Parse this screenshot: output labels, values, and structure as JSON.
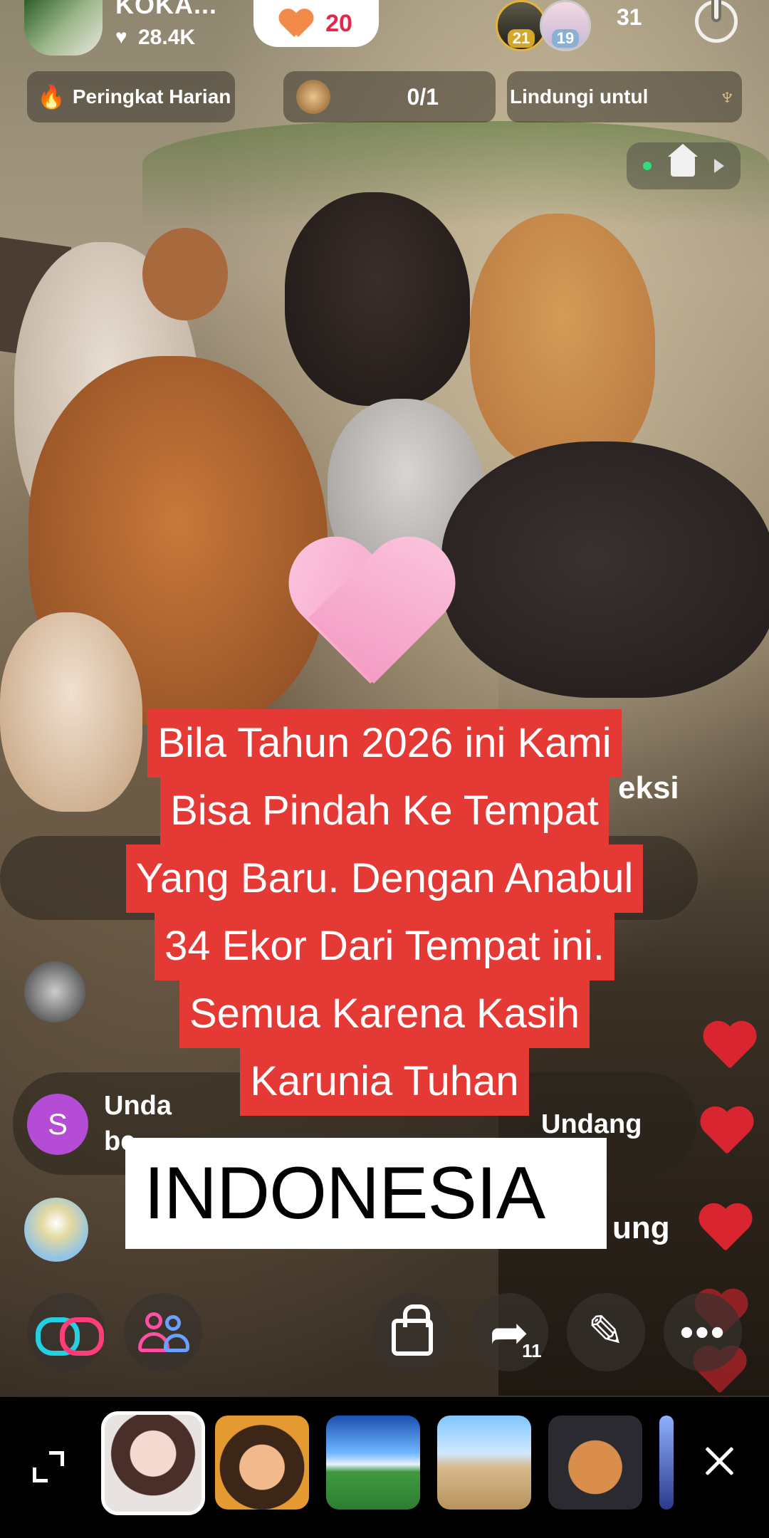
{
  "host": {
    "name": "KOKA...",
    "likes": "28.4K",
    "heart_icon": "heart-icon"
  },
  "like_pill": {
    "count": "20",
    "icon": "orange-heart-icon",
    "color": "#f28b4a"
  },
  "viewers": {
    "avatar_1_level": "21",
    "avatar_2_level": "19",
    "count": "31"
  },
  "chips": {
    "rank_label": "Peringkat Harian",
    "goal_progress": "0/1",
    "protect_label": "Lindungi untul"
  },
  "caption": {
    "lines": [
      "Bila   Tahun 2026 ini Kami",
      "Bisa Pindah Ke Tempat",
      "Yang Baru. Dengan Anabul",
      "34 Ekor Dari Tempat ini.",
      "Semua Karena Kasih",
      "Karunia Tuhan"
    ],
    "country": "INDONESIA",
    "bg_color": "#e53935"
  },
  "comments": {
    "c1_avatar_letter": "S",
    "c1_line1": "Unda",
    "c1_line2": "be",
    "c1_right": "Undang",
    "c2_right": "ung",
    "c3_fragment": "eksi"
  },
  "actions": {
    "share_count": "11",
    "more_label": "•••"
  },
  "effects": [
    "effect-face-sticker",
    "effect-cartoon-girl",
    "effect-stadium",
    "effect-desert-town",
    "effect-gingerbread"
  ]
}
